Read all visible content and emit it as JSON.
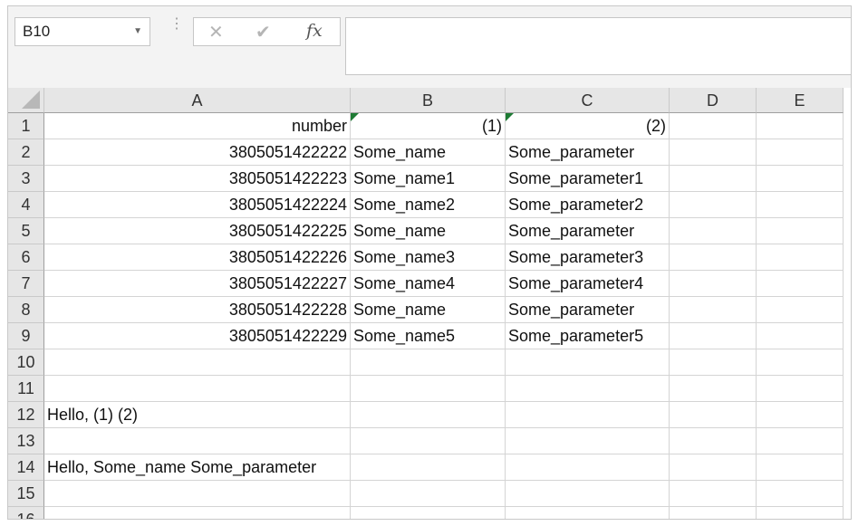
{
  "name_box": {
    "value": "B10",
    "dropdown_icon": "chevron-down-icon"
  },
  "formula_bar": {
    "cancel_icon": "close-icon",
    "enter_icon": "check-icon",
    "function_label": "fx",
    "value": ""
  },
  "columns": [
    "A",
    "B",
    "C",
    "D",
    "E"
  ],
  "rows": [
    "1",
    "2",
    "3",
    "4",
    "5",
    "6",
    "7",
    "8",
    "9",
    "10",
    "11",
    "12",
    "13",
    "14",
    "15",
    "16"
  ],
  "cells": {
    "A1": "number",
    "B1": "(1)",
    "C1": "(2)",
    "A2": "3805051422222",
    "B2": "Some_name",
    "C2": "Some_parameter",
    "A3": "3805051422223",
    "B3": "Some_name1",
    "C3": "Some_parameter1",
    "A4": "3805051422224",
    "B4": "Some_name2",
    "C4": "Some_parameter2",
    "A5": "3805051422225",
    "B5": "Some_name",
    "C5": "Some_parameter",
    "A6": "3805051422226",
    "B6": "Some_name3",
    "C6": "Some_parameter3",
    "A7": "3805051422227",
    "B7": "Some_name4",
    "C7": "Some_parameter4",
    "A8": "3805051422228",
    "B8": "Some_name",
    "C8": "Some_parameter",
    "A9": "3805051422229",
    "B9": "Some_name5",
    "C9": "Some_parameter5",
    "A12": "Hello, (1) (2)",
    "A14": "Hello, Some_name Some_parameter"
  },
  "colors": {
    "error_indicator": "#1e7b34",
    "header_bg": "#e6e6e6"
  }
}
